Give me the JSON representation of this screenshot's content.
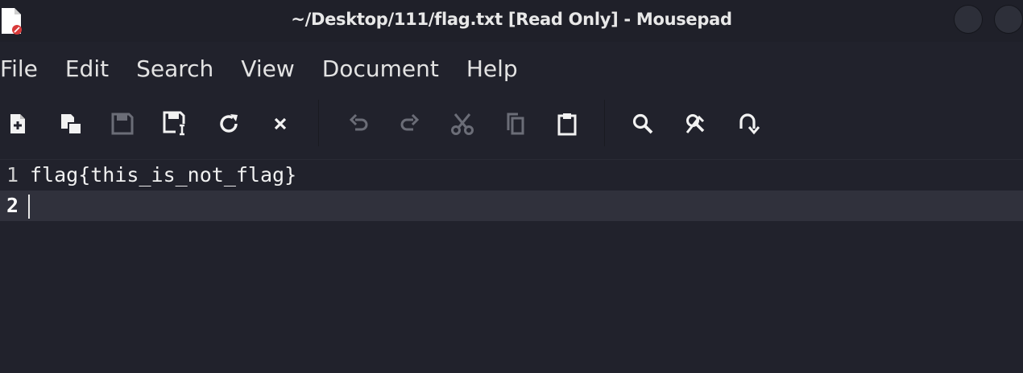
{
  "window": {
    "title": "~/Desktop/111/flag.txt [Read Only] - Mousepad"
  },
  "menubar": {
    "items": [
      "File",
      "Edit",
      "Search",
      "View",
      "Document",
      "Help"
    ]
  },
  "toolbar": {
    "buttons": [
      {
        "icon": "new-document-icon",
        "enabled": true
      },
      {
        "icon": "new-window-icon",
        "enabled": true
      },
      {
        "icon": "save-icon",
        "enabled": false
      },
      {
        "icon": "save-as-icon",
        "enabled": true
      },
      {
        "icon": "reload-icon",
        "enabled": true
      },
      {
        "icon": "close-icon",
        "enabled": true
      },
      {
        "icon": "undo-icon",
        "enabled": false
      },
      {
        "icon": "redo-icon",
        "enabled": false
      },
      {
        "icon": "cut-icon",
        "enabled": false
      },
      {
        "icon": "copy-icon",
        "enabled": false
      },
      {
        "icon": "paste-icon",
        "enabled": true
      },
      {
        "icon": "find-icon",
        "enabled": true
      },
      {
        "icon": "find-replace-icon",
        "enabled": true
      },
      {
        "icon": "go-to-line-icon",
        "enabled": true
      }
    ]
  },
  "editor": {
    "lines": [
      {
        "number": "1",
        "text": "flag{this_is_not_flag}"
      },
      {
        "number": "2",
        "text": ""
      }
    ]
  },
  "colors": {
    "background": "#21222c",
    "current_line": "#30313c",
    "text": "#e6e6e6",
    "disabled_icon": "#6b6d77"
  }
}
